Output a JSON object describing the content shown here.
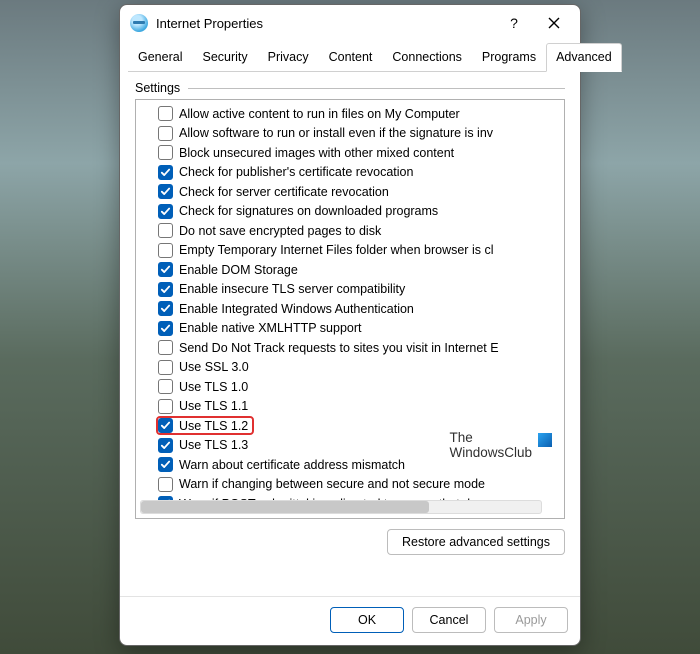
{
  "window": {
    "title": "Internet Properties"
  },
  "tabs": [
    {
      "label": "General",
      "active": false
    },
    {
      "label": "Security",
      "active": false
    },
    {
      "label": "Privacy",
      "active": false
    },
    {
      "label": "Content",
      "active": false
    },
    {
      "label": "Connections",
      "active": false
    },
    {
      "label": "Programs",
      "active": false
    },
    {
      "label": "Advanced",
      "active": true
    }
  ],
  "group": {
    "label": "Settings"
  },
  "settings": [
    {
      "checked": false,
      "label": "Allow active content to run in files on My Computer"
    },
    {
      "checked": false,
      "label": "Allow software to run or install even if the signature is inv"
    },
    {
      "checked": false,
      "label": "Block unsecured images with other mixed content"
    },
    {
      "checked": true,
      "label": "Check for publisher's certificate revocation"
    },
    {
      "checked": true,
      "label": "Check for server certificate revocation"
    },
    {
      "checked": true,
      "label": "Check for signatures on downloaded programs"
    },
    {
      "checked": false,
      "label": "Do not save encrypted pages to disk"
    },
    {
      "checked": false,
      "label": "Empty Temporary Internet Files folder when browser is cl"
    },
    {
      "checked": true,
      "label": "Enable DOM Storage"
    },
    {
      "checked": true,
      "label": "Enable insecure TLS server compatibility"
    },
    {
      "checked": true,
      "label": "Enable Integrated Windows Authentication"
    },
    {
      "checked": true,
      "label": "Enable native XMLHTTP support"
    },
    {
      "checked": false,
      "label": "Send Do Not Track requests to sites you visit in Internet E"
    },
    {
      "checked": false,
      "label": "Use SSL 3.0"
    },
    {
      "checked": false,
      "label": "Use TLS 1.0"
    },
    {
      "checked": false,
      "label": "Use TLS 1.1"
    },
    {
      "checked": true,
      "label": "Use TLS 1.2",
      "highlight": true
    },
    {
      "checked": true,
      "label": "Use TLS 1.3"
    },
    {
      "checked": true,
      "label": "Warn about certificate address mismatch"
    },
    {
      "checked": false,
      "label": "Warn if changing between secure and not secure mode"
    },
    {
      "checked": true,
      "label": "Warn if POST submittal is redirected to a zone that does n"
    }
  ],
  "buttons": {
    "restore": "Restore advanced settings",
    "ok": "OK",
    "cancel": "Cancel",
    "apply": "Apply"
  },
  "watermark": {
    "line1": "The",
    "line2": "WindowsClub"
  }
}
